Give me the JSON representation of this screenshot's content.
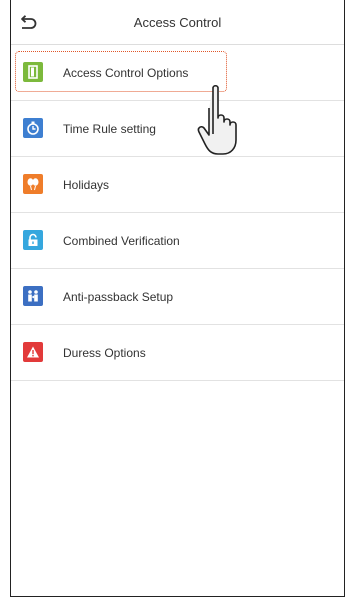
{
  "header": {
    "title": "Access Control",
    "back_icon": "back-arrow-icon"
  },
  "menu": {
    "items": [
      {
        "label": "Access Control Options",
        "icon": "door-icon",
        "color": "#7cb93c",
        "selected": true
      },
      {
        "label": "Time Rule setting",
        "icon": "stopwatch-icon",
        "color": "#3e7fd1"
      },
      {
        "label": "Holidays",
        "icon": "balloons-icon",
        "color": "#ef7d2a"
      },
      {
        "label": "Combined Verification",
        "icon": "lock-icon",
        "color": "#35a7de"
      },
      {
        "label": "Anti-passback Setup",
        "icon": "people-icon",
        "color": "#3c6fc2"
      },
      {
        "label": "Duress Options",
        "icon": "warning-icon",
        "color": "#e23a3a"
      }
    ]
  },
  "colors": {
    "focus_outline": "#e0562a",
    "divider": "#e2e2e2"
  }
}
